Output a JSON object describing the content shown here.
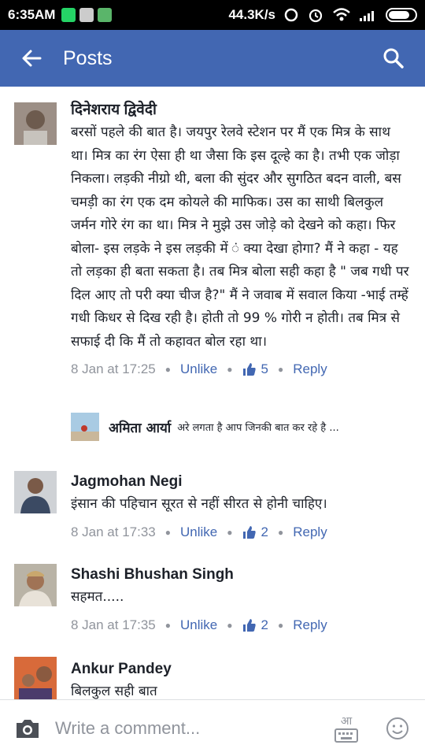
{
  "status_bar": {
    "time": "6:35AM",
    "network_speed": "44.3K/s"
  },
  "app_bar": {
    "title": "Posts",
    "back_icon": "arrow-left-icon",
    "search_icon": "search-icon"
  },
  "comments": [
    {
      "author": "दिनेशराय द्विवेदी",
      "text": "बरसों पहले की बात है। जयपुर रेलवे स्टेशन पर मैं एक मित्र के साथ था। मित्र का रंग ऐसा ही था जैसा कि इस दूल्हे का है। तभी एक जोड़ा निकला। लड़की नीग्रो थी, बला की सुंदर और सुगठित बदन वाली, बस चमड़ी का रंग एक दम कोयले की माफिक। उस का साथी बिलकुल जर्मन गोरे रंग का था। मित्र ने मुझे उस जोड़े को देखने को कहा। फिर बोला- इस लड़के ने इस लड़की में ं क्या देखा होगा? मैं ने कहा - यह तो लड़का ही बता सकता है। तब मित्र बोला सही कहा है \" जब गधी पर दिल आए तो परी क्या चीज है?\" मैं ने जवाब में सवाल किया -भाई तम्हें गधी किधर से दिख रही है। होती तो 99 % गोरी न होती। तब मित्र से सफाई दी कि मैं तो कहावत बोल रहा था।",
      "time": "8 Jan at 17:25",
      "unlike": "Unlike",
      "likes": "5",
      "reply": "Reply",
      "reply_preview": {
        "author": "अमिता आर्या",
        "text": "अरे लगता है आप जिनकी बात कर रहे है ..."
      }
    },
    {
      "author": "Jagmohan Negi",
      "text": "इंसान की पहिचान सूरत से नहीं सीरत से होनी चाहिए।",
      "time": "8 Jan at 17:33",
      "unlike": "Unlike",
      "likes": "2",
      "reply": "Reply"
    },
    {
      "author": "Shashi Bhushan Singh",
      "text": "सहमत.....",
      "time": "8 Jan at 17:35",
      "unlike": "Unlike",
      "likes": "2",
      "reply": "Reply"
    },
    {
      "author": "Ankur Pandey",
      "text": "बिलकुल सही बात"
    }
  ],
  "composer": {
    "placeholder": "Write a comment...",
    "keyboard_label": "आ"
  },
  "colors": {
    "brand_blue": "#4267b2",
    "meta_gray": "#90949c"
  }
}
